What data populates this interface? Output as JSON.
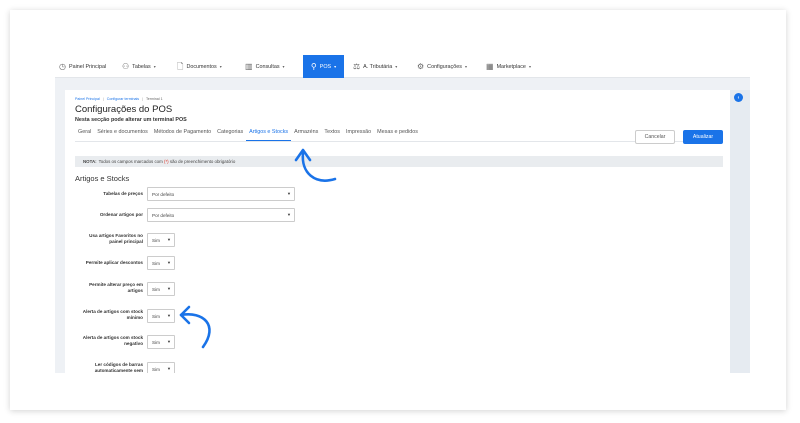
{
  "nav": {
    "items": [
      {
        "label": "Painel Principal",
        "icon": "dashboard-icon",
        "chevron": ""
      },
      {
        "label": "Tabelas",
        "icon": "tables-icon",
        "chevron": "▾"
      },
      {
        "label": "Documentos",
        "icon": "document-icon",
        "chevron": "▾"
      },
      {
        "label": "Consultas",
        "icon": "chart-icon",
        "chevron": "▾"
      },
      {
        "label": "POS",
        "icon": "pos-icon",
        "chevron": "▾"
      },
      {
        "label": "A. Tributária",
        "icon": "tax-icon",
        "chevron": "▾"
      },
      {
        "label": "Configurações",
        "icon": "settings-icon",
        "chevron": "▾"
      },
      {
        "label": "Marketplace",
        "icon": "marketplace-icon",
        "chevron": "▾"
      }
    ]
  },
  "breadcrumb": [
    "Painel Principal",
    "Configurar terminais",
    "Terminal 1"
  ],
  "page": {
    "title": "Configurações do POS",
    "subtitle": "Nesta secção pode alterar um terminal POS"
  },
  "tabs": [
    "Geral",
    "Séries e documentos",
    "Métodos de Pagamento",
    "Categorias",
    "Artigos e Stocks",
    "Armazéns",
    "Textos",
    "Impressão",
    "Mesas e pedidos"
  ],
  "active_tab": "Artigos e Stocks",
  "buttons": {
    "cancel": "Cancelar",
    "update": "Atualizar"
  },
  "note": {
    "prefix": "NOTA:",
    "text_before": "Todos os campos marcados com",
    "star": "(*)",
    "text_after": "são de preenchimento obrigatório"
  },
  "section_title": "Artigos e Stocks",
  "form": [
    {
      "label": "Tabelas de preços",
      "value": "Por defeito"
    },
    {
      "label": "Ordenar artigos por",
      "value": "Por defeito"
    },
    {
      "label": "Usa artigos Favoritos no painel principal",
      "value": "Sim"
    },
    {
      "label": "Permite aplicar descontos",
      "value": "Sim"
    },
    {
      "label": "Permite alterar preço em artigos",
      "value": "Sim"
    },
    {
      "label": "Alerta de artigos com stock mínimo",
      "value": "Sim"
    },
    {
      "label": "Alerta de artigos com stock negativo",
      "value": "Sim"
    },
    {
      "label": "Ler códigos de barras automaticamente sem",
      "value": "Sim"
    }
  ],
  "colors": {
    "accent": "#1a73e8",
    "background": "#eef1f5",
    "required": "#d93025"
  }
}
